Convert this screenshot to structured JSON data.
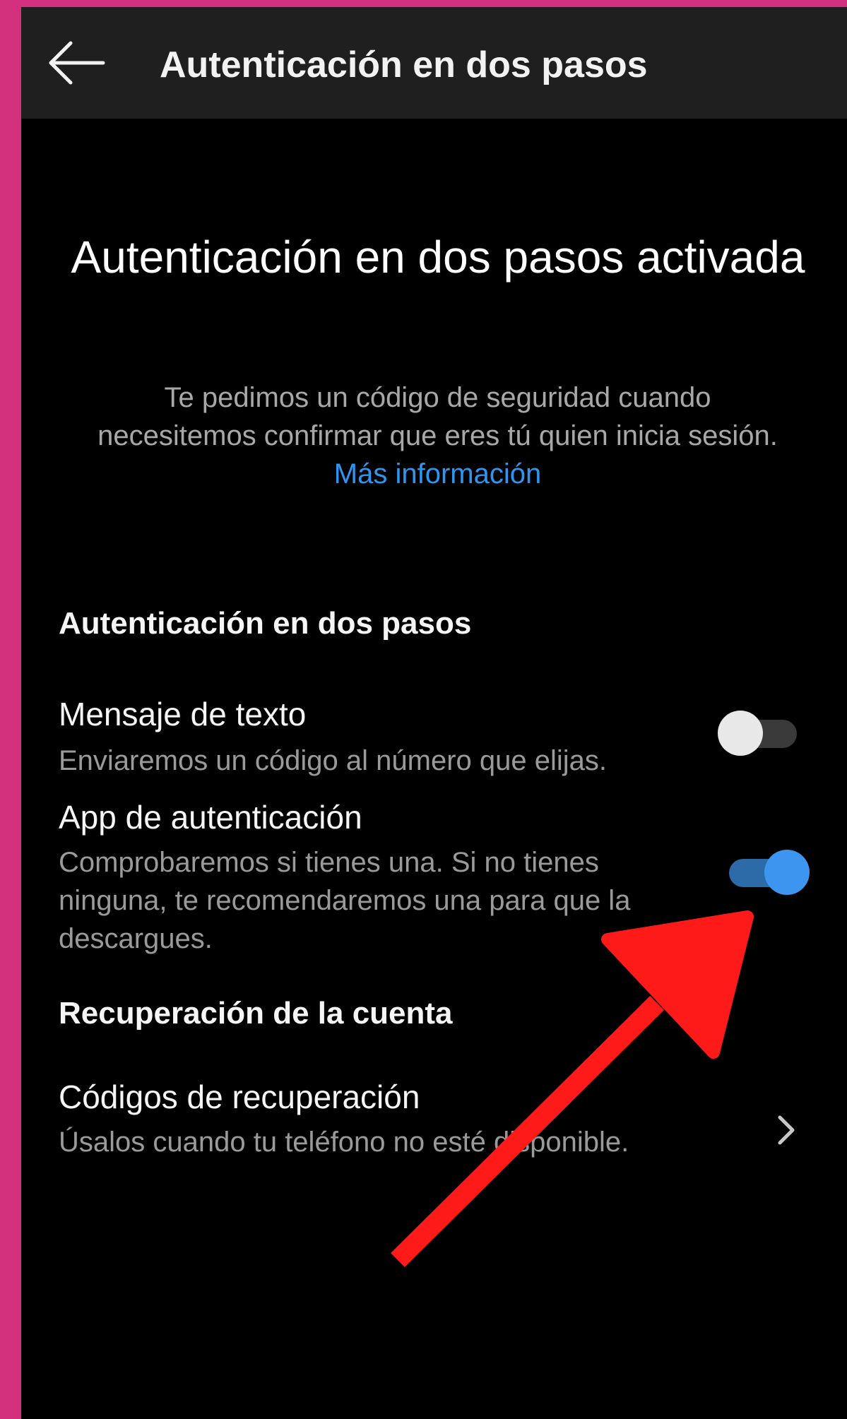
{
  "header": {
    "back_icon": "arrow-left-icon",
    "title": "Autenticación en dos pasos"
  },
  "hero": {
    "title": "Autenticación en dos pasos activada",
    "description": "Te pedimos un código de seguridad cuando necesitemos confirmar que eres tú quien inicia sesión.",
    "link": "Más información"
  },
  "two_step_section": {
    "header": "Autenticación en dos pasos",
    "items": [
      {
        "title": "Mensaje de texto",
        "description": "Enviaremos un código al número que elijas.",
        "enabled": false
      },
      {
        "title": "App de autenticación",
        "description": "Comprobaremos si tienes una. Si no tienes ninguna, te recomendaremos una para que la descargues.",
        "enabled": true
      }
    ]
  },
  "recovery_section": {
    "header": "Recuperación de la cuenta",
    "items": [
      {
        "title": "Códigos de recuperación",
        "description": "Úsalos cuando tu teléfono no esté disponible.",
        "icon": "chevron-right-icon"
      }
    ]
  },
  "colors": {
    "frame": "#d2307c",
    "accent": "#3d95ef",
    "annotation_arrow": "#ff1a1a"
  }
}
